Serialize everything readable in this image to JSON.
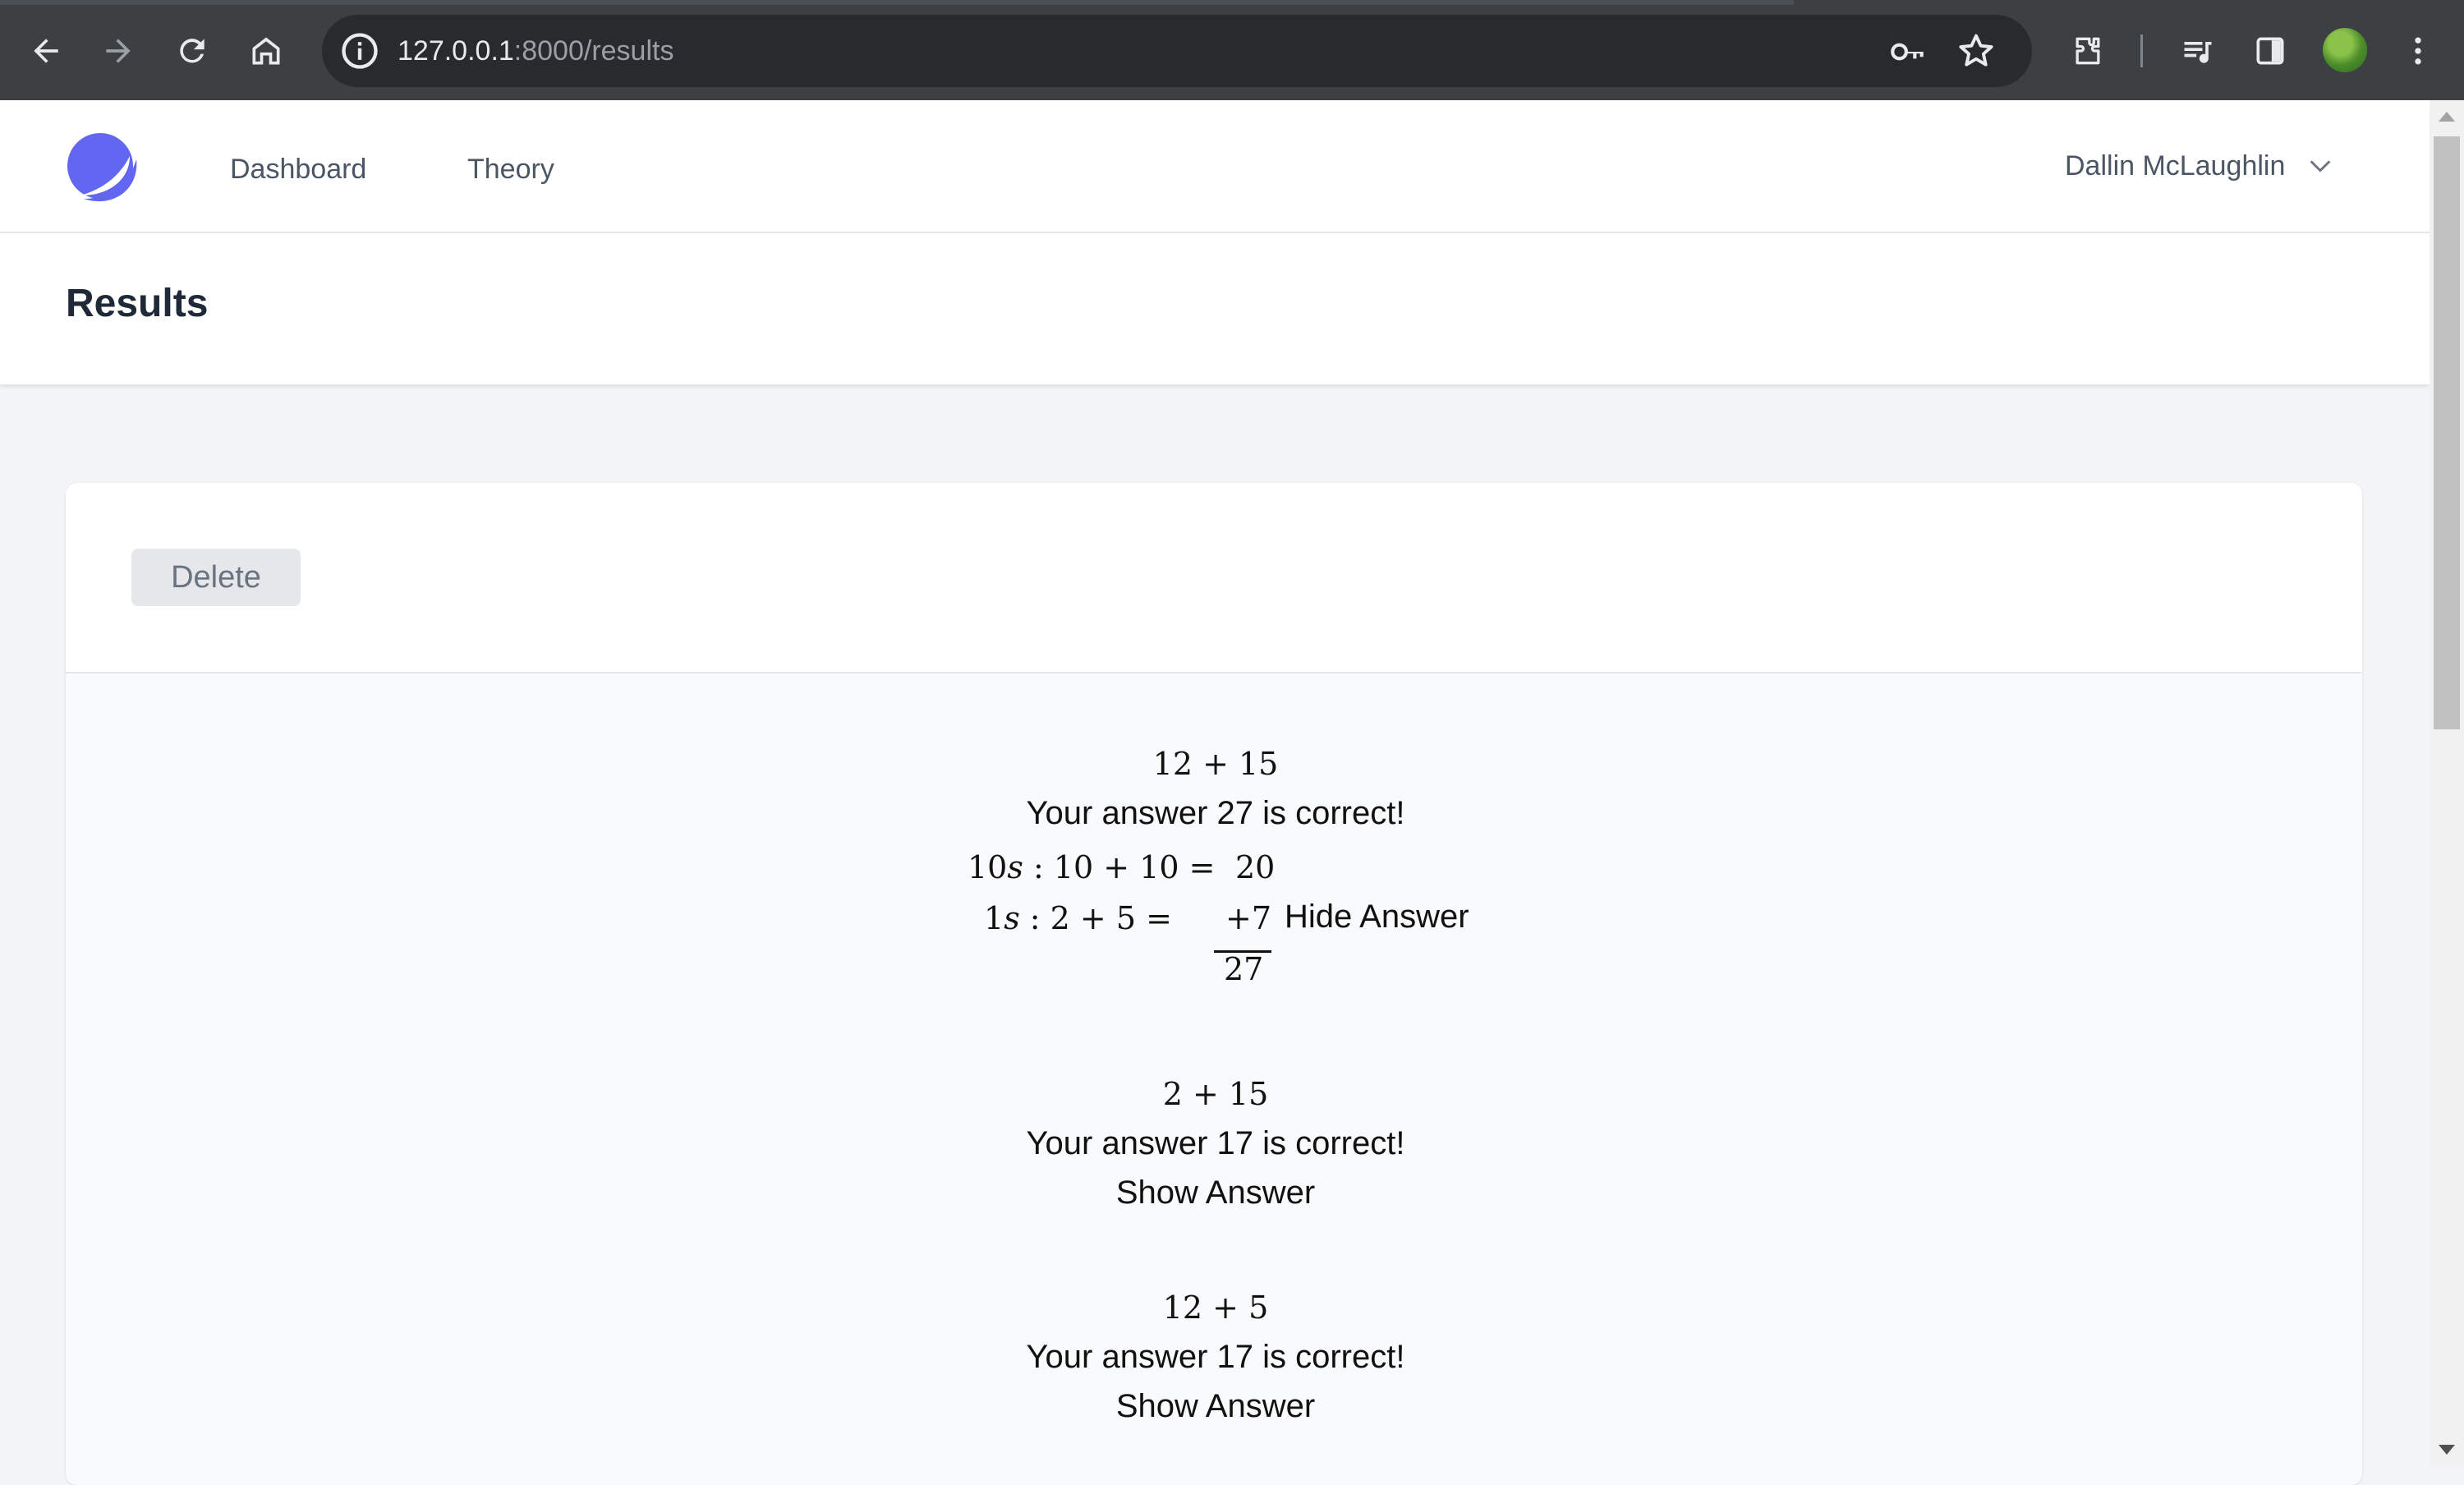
{
  "browser": {
    "url_host": "127.0.0.1",
    "url_rest": ":8000/results",
    "icons": [
      "back-arrow-icon",
      "forward-arrow-icon",
      "reload-icon",
      "home-icon",
      "site-info-icon",
      "key-icon",
      "star-icon",
      "extensions-icon",
      "media-queue-icon",
      "side-panel-icon",
      "profile-avatar",
      "kebab-menu-icon"
    ]
  },
  "nav": {
    "links": [
      "Dashboard",
      "Theory"
    ],
    "user_name": "Dallin McLaughlin"
  },
  "page": {
    "title": "Results"
  },
  "toolbar": {
    "delete_label": "Delete"
  },
  "results": [
    {
      "problem": "12 + 15",
      "message": "Your answer 27 is correct!",
      "toggle_label": "Hide Answer",
      "working": {
        "tens_label": "10",
        "tens_var": "s",
        "tens_expr": " : 10 + 10 =",
        "tens_value": "20",
        "ones_label": "1",
        "ones_var": "s",
        "ones_expr": " : 2 + 5 =",
        "ones_value": "+7",
        "total": "27"
      }
    },
    {
      "problem": "2 + 15",
      "message": "Your answer 17 is correct!",
      "toggle_label": "Show Answer"
    },
    {
      "problem": "12 + 5",
      "message": "Your answer 17 is correct!",
      "toggle_label": "Show Answer"
    }
  ],
  "colors": {
    "chrome_bg": "#3c4043",
    "omnibox_bg": "#282a2d",
    "logo_accent": "#6366f1",
    "page_bg": "#f3f4f6",
    "button_bg": "#e5e7eb"
  }
}
